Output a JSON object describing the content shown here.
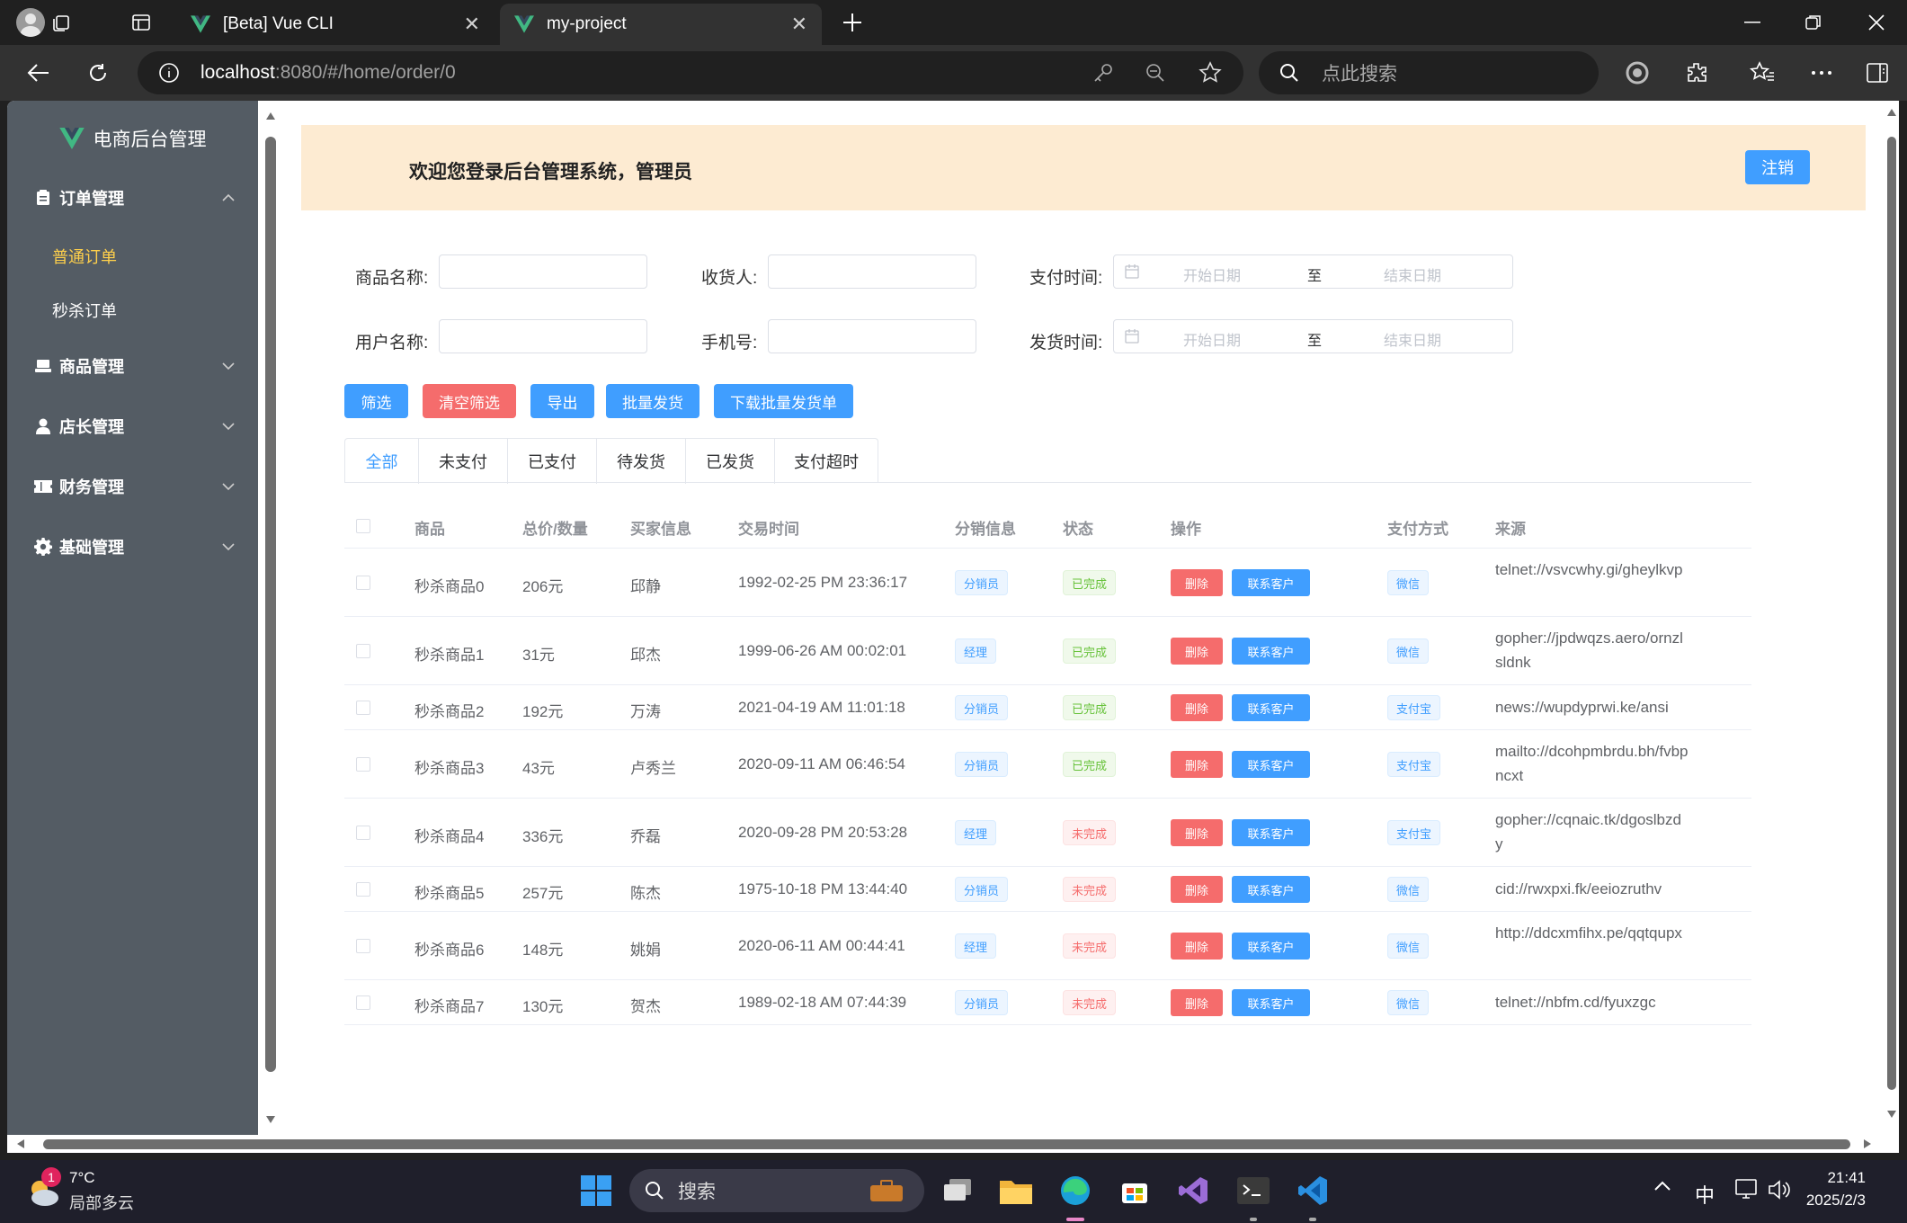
{
  "browser": {
    "tabs": [
      {
        "title": "[Beta] Vue CLI",
        "active": false
      },
      {
        "title": "my-project",
        "active": true
      }
    ],
    "url_host": "localhost",
    "url_rest": ":8080/#/home/order/0",
    "search_placeholder": "点此搜索"
  },
  "sidebar": {
    "brand": "电商后台管理",
    "menus": [
      {
        "label": "订单管理",
        "icon": "document-icon",
        "expanded": true,
        "children": [
          {
            "label": "普通订单",
            "active": true
          },
          {
            "label": "秒杀订单",
            "active": false
          }
        ]
      },
      {
        "label": "商品管理",
        "icon": "goods-icon"
      },
      {
        "label": "店长管理",
        "icon": "user-icon"
      },
      {
        "label": "财务管理",
        "icon": "ticket-icon"
      },
      {
        "label": "基础管理",
        "icon": "gear-icon"
      }
    ]
  },
  "header": {
    "welcome": "欢迎您登录后台管理系统，管理员",
    "logout": "注销"
  },
  "filters": {
    "product_name_label": "商品名称:",
    "receiver_label": "收货人:",
    "pay_time_label": "支付时间:",
    "username_label": "用户名称:",
    "phone_label": "手机号:",
    "ship_time_label": "发货时间:",
    "start_placeholder": "开始日期",
    "end_placeholder": "结束日期",
    "range_sep": "至"
  },
  "actions": {
    "filter": "筛选",
    "clear": "清空筛选",
    "export": "导出",
    "batch_ship": "批量发货",
    "download_batch": "下载批量发货单"
  },
  "status_tabs": [
    "全部",
    "未支付",
    "已支付",
    "待发货",
    "已发货",
    "支付超时"
  ],
  "table": {
    "headers": [
      "商品",
      "总价/数量",
      "买家信息",
      "交易时间",
      "分销信息",
      "状态",
      "操作",
      "支付方式",
      "来源"
    ],
    "delete_label": "删除",
    "contact_label": "联系客户",
    "rows": [
      {
        "product": "秒杀商品0",
        "price": "206元",
        "buyer": "邱静",
        "time": "1992-02-25 PM 23:36:17",
        "dist": "分销员",
        "status": "已完成",
        "done": true,
        "pay": "微信",
        "source": "telnet://vsvcwhy.gi/gheylkvp"
      },
      {
        "product": "秒杀商品1",
        "price": "31元",
        "buyer": "邱杰",
        "time": "1999-06-26 AM 00:02:01",
        "dist": "经理",
        "status": "已完成",
        "done": true,
        "pay": "微信",
        "source": "gopher://jpdwqzs.aero/ornzlsldnk"
      },
      {
        "product": "秒杀商品2",
        "price": "192元",
        "buyer": "万涛",
        "time": "2021-04-19 AM 11:01:18",
        "dist": "分销员",
        "status": "已完成",
        "done": true,
        "pay": "支付宝",
        "source": "news://wupdyprwi.ke/ansi"
      },
      {
        "product": "秒杀商品3",
        "price": "43元",
        "buyer": "卢秀兰",
        "time": "2020-09-11 AM 06:46:54",
        "dist": "分销员",
        "status": "已完成",
        "done": true,
        "pay": "支付宝",
        "source": "mailto://dcohpmbrdu.bh/fvbpncxt"
      },
      {
        "product": "秒杀商品4",
        "price": "336元",
        "buyer": "乔磊",
        "time": "2020-09-28 PM 20:53:28",
        "dist": "经理",
        "status": "未完成",
        "done": false,
        "pay": "支付宝",
        "source": "gopher://cqnaic.tk/dgoslbzdy"
      },
      {
        "product": "秒杀商品5",
        "price": "257元",
        "buyer": "陈杰",
        "time": "1975-10-18 PM 13:44:40",
        "dist": "分销员",
        "status": "未完成",
        "done": false,
        "pay": "微信",
        "source": "cid://rwxpxi.fk/eeiozruthv"
      },
      {
        "product": "秒杀商品6",
        "price": "148元",
        "buyer": "姚娟",
        "time": "2020-06-11 AM 00:44:41",
        "dist": "经理",
        "status": "未完成",
        "done": false,
        "pay": "微信",
        "source": "http://ddcxmfihx.pe/qqtqupx"
      },
      {
        "product": "秒杀商品7",
        "price": "130元",
        "buyer": "贺杰",
        "time": "1989-02-18 AM 07:44:39",
        "dist": "分销员",
        "status": "未完成",
        "done": false,
        "pay": "微信",
        "source": "telnet://nbfm.cd/fyuxzgc"
      }
    ]
  },
  "taskbar": {
    "temp": "7°C",
    "weather": "局部多云",
    "weather_badge": "1",
    "search_placeholder": "搜索",
    "ime": "中",
    "time": "21:41",
    "date": "2025/2/3"
  },
  "colors": {
    "primary": "#409eff",
    "danger": "#f56c6c",
    "success": "#67c23a",
    "sidebar": "#545c64",
    "active_menu": "#ffd04b",
    "header_bg": "#fdebd2"
  }
}
